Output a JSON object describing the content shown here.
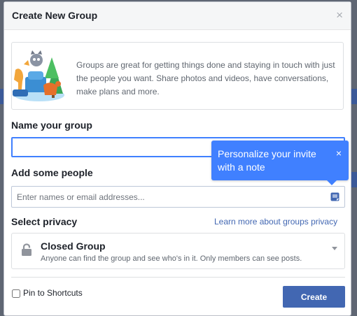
{
  "dialog": {
    "title": "Create New Group",
    "close_glyph": "×"
  },
  "intro": {
    "text": "Groups are great for getting things done and staying in touch with just the people you want. Share photos and videos, have conversations, make plans and more."
  },
  "name_section": {
    "label": "Name your group",
    "value": "",
    "placeholder": ""
  },
  "people_section": {
    "label": "Add some people",
    "placeholder": "Enter names or email addresses...",
    "note_icon": "note-icon"
  },
  "tooltip": {
    "text": "Personalize your invite with a note",
    "close_glyph": "×"
  },
  "privacy": {
    "label": "Select privacy",
    "link": "Learn more about groups privacy",
    "selected_title": "Closed Group",
    "selected_desc": "Anyone can find the group and see who's in it. Only members can see posts.",
    "icon": "lock-icon"
  },
  "footer": {
    "pin_label": "Pin to Shortcuts",
    "pin_checked": false,
    "create_label": "Create"
  },
  "colors": {
    "accent": "#4080ff",
    "brand": "#4267b2",
    "overlay": "#5f6673"
  }
}
